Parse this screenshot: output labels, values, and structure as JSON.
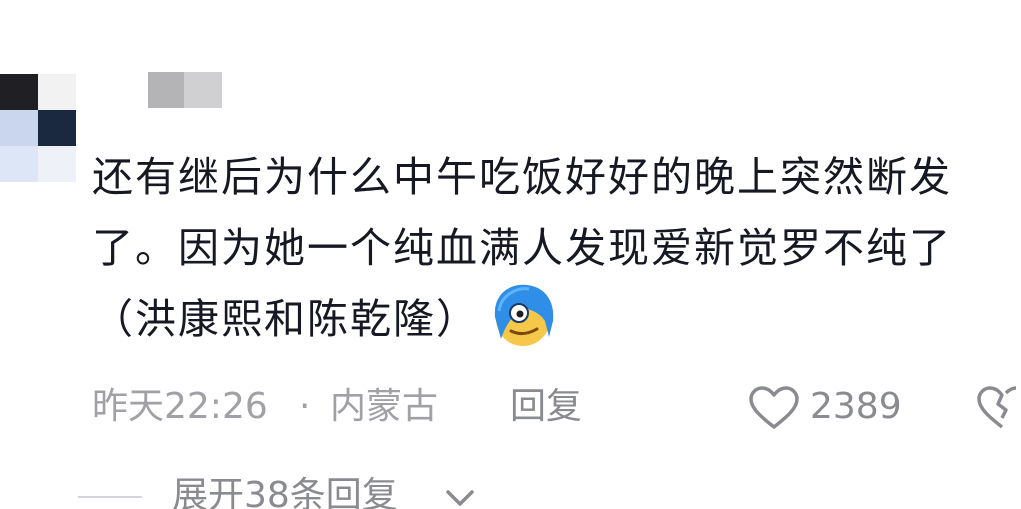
{
  "comment": {
    "text": "还有继后为什么中午吃饭好好的晚上突然断发了。因为她一个纯血满人发现爱新觉罗不纯了（洪康熙和陈乾隆）",
    "emoji_icon": "blue-hair-smirk-face-icon",
    "time": "昨天22:26",
    "dot": "·",
    "location": "内蒙古",
    "reply_label": "回复",
    "like_count": "2389",
    "expand_label": "展开38条回复"
  },
  "colors": {
    "text": "#161823",
    "meta": "#a0a0a6",
    "action": "#8a8b91"
  }
}
